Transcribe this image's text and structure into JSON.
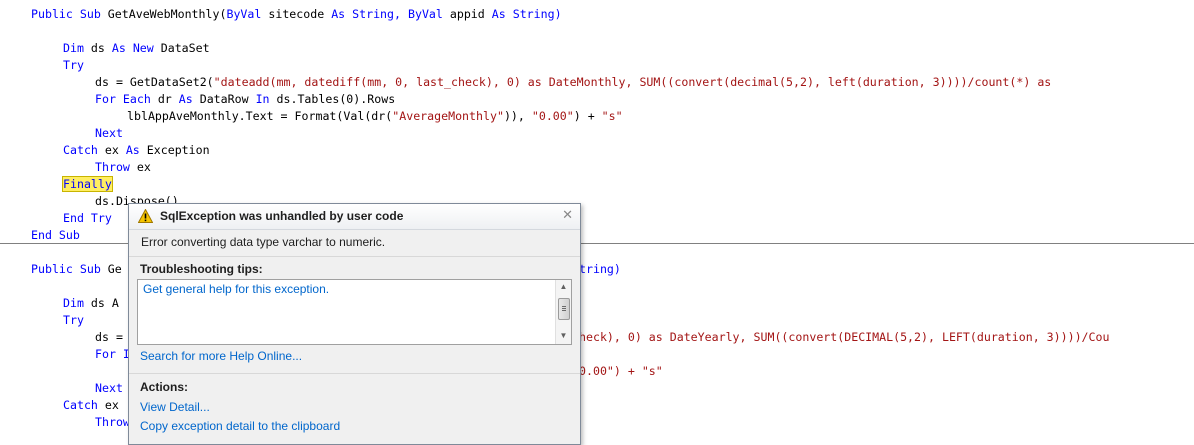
{
  "code": {
    "method1": {
      "sub_keywords": "Public Sub",
      "signature_name": "GetAveWebMonthly(",
      "byval1": "ByVal",
      "param1": " sitecode ",
      "as1": "As",
      "type1": " String, ",
      "byval2": "ByVal",
      "param2": " appid ",
      "as2": "As",
      "type2": " String)",
      "dim_kw": "Dim",
      "dim_var": " ds ",
      "as_new": "As New",
      "dim_type": " DataSet",
      "try_kw": "Try",
      "call_prefix": "ds = GetDataSet2(",
      "call_string": "\"dateadd(mm, datediff(mm, 0, last_check), 0) as DateMonthly, SUM((convert(decimal(5,2), left(duration, 3))))/count(*) as",
      "for_each_kw": "For Each",
      "for_var": " dr ",
      "for_as": "As",
      "for_type": " DataRow ",
      "for_in": "In",
      "for_rest": " ds.Tables(0).Rows",
      "assign_prefix": "lblAppAveMonthly.Text = Format(Val(dr(",
      "assign_str1": "\"AverageMonthly\"",
      "assign_mid": ")), ",
      "assign_str2": "\"0.00\"",
      "assign_plus": ") + ",
      "assign_str3": "\"s\"",
      "next_kw": "Next",
      "catch_kw": "Catch",
      "catch_var": " ex ",
      "catch_as": "As",
      "catch_type": " Exception",
      "throw_kw": "Throw",
      "throw_var": " ex",
      "finally_kw": "Finally",
      "dispose": "ds.Dispose()",
      "end_try": "End Try",
      "end_sub": "End Sub"
    },
    "method2": {
      "sub_keywords": "Public Sub",
      "signature_start": "Ge",
      "signature_end": "tring)",
      "dim_kw": "Dim",
      "dim_var": " ds A",
      "try_kw": "Try",
      "call_prefix": "ds =",
      "call_visible": "heck), 0) as DateYearly, SUM((convert(DECIMAL(5,2), LEFT(duration, 3))))/Cou",
      "for_kw": "For",
      "for_rest": " I",
      "line_fragment": "0.00\") + \"s\"",
      "next_kw": "Next",
      "catch_kw": "Catch",
      "catch_var": " ex",
      "throw_kw": "Throw"
    }
  },
  "exception": {
    "title": "SqlException was unhandled by user code",
    "message": "Error converting data type varchar to numeric.",
    "close_glyph": "✕",
    "tips_heading": "Troubleshooting tips:",
    "tips": [
      "Get general help for this exception."
    ],
    "search_link": "Search for more Help Online...",
    "actions_heading": "Actions:",
    "actions": [
      "View Detail...",
      "Copy exception detail to the clipboard"
    ]
  },
  "colors": {
    "keyword": "#0000ff",
    "string": "#a31515",
    "highlight": "#ffee62",
    "link": "#0066cc"
  }
}
